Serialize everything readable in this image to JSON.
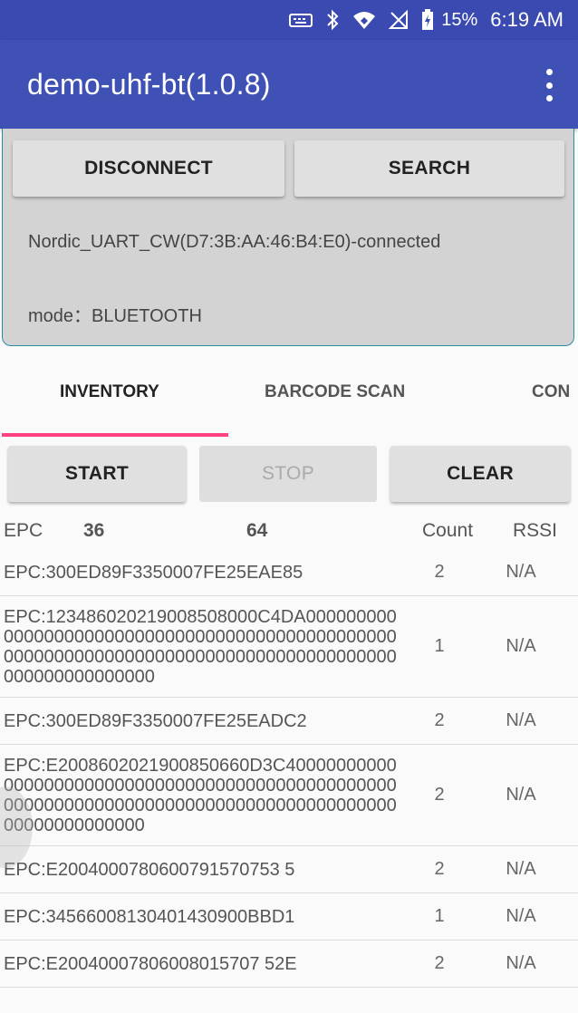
{
  "status_bar": {
    "icons": [
      "keyboard-icon",
      "bluetooth-icon",
      "wifi-icon",
      "signal-off-icon",
      "battery-charging-icon"
    ],
    "battery": "15%",
    "time": "6:19 AM"
  },
  "app_bar": {
    "title": "demo-uhf-bt(1.0.8)"
  },
  "connection": {
    "disconnect_label": "DISCONNECT",
    "search_label": "SEARCH",
    "device": "Nordic_UART_CW(D7:3B:AA:46:B4:E0)-connected",
    "mode": "mode：BLUETOOTH"
  },
  "tabs": [
    {
      "label": "INVENTORY",
      "active": true
    },
    {
      "label": "BARCODE SCAN",
      "active": false
    },
    {
      "label": "CON",
      "active": false
    }
  ],
  "actions": {
    "start_label": "START",
    "stop_label": "STOP",
    "clear_label": "CLEAR"
  },
  "summary": {
    "epc_label": "EPC",
    "total": "36",
    "count": "64",
    "count_header": "Count",
    "rssi_header": "RSSI"
  },
  "rows": [
    {
      "epc": "EPC:300ED89F3350007FE25EAE85",
      "count": "2",
      "rssi": "N/A"
    },
    {
      "epc": "EPC:123486020219008508000C4DA000000000000000000000000000000000000000000000000000000000000000000000000000000000000000000000000000000",
      "count": "1",
      "rssi": "N/A"
    },
    {
      "epc": "EPC:300ED89F3350007FE25EADC2",
      "count": "2",
      "rssi": "N/A"
    },
    {
      "epc": "EPC:E2008602021900850660D3C4000000000000000000000000000000000000000000000000000000000000000000000000000000000000000000000000000000",
      "count": "2",
      "rssi": "N/A"
    },
    {
      "epc": "EPC:E2004000780600791570753 5",
      "count": "2",
      "rssi": "N/A"
    },
    {
      "epc": "EPC:34566008130401430900BBD1",
      "count": "1",
      "rssi": "N/A"
    },
    {
      "epc": "EPC:E20040007806008015707 52E",
      "count": "2",
      "rssi": "N/A"
    }
  ]
}
